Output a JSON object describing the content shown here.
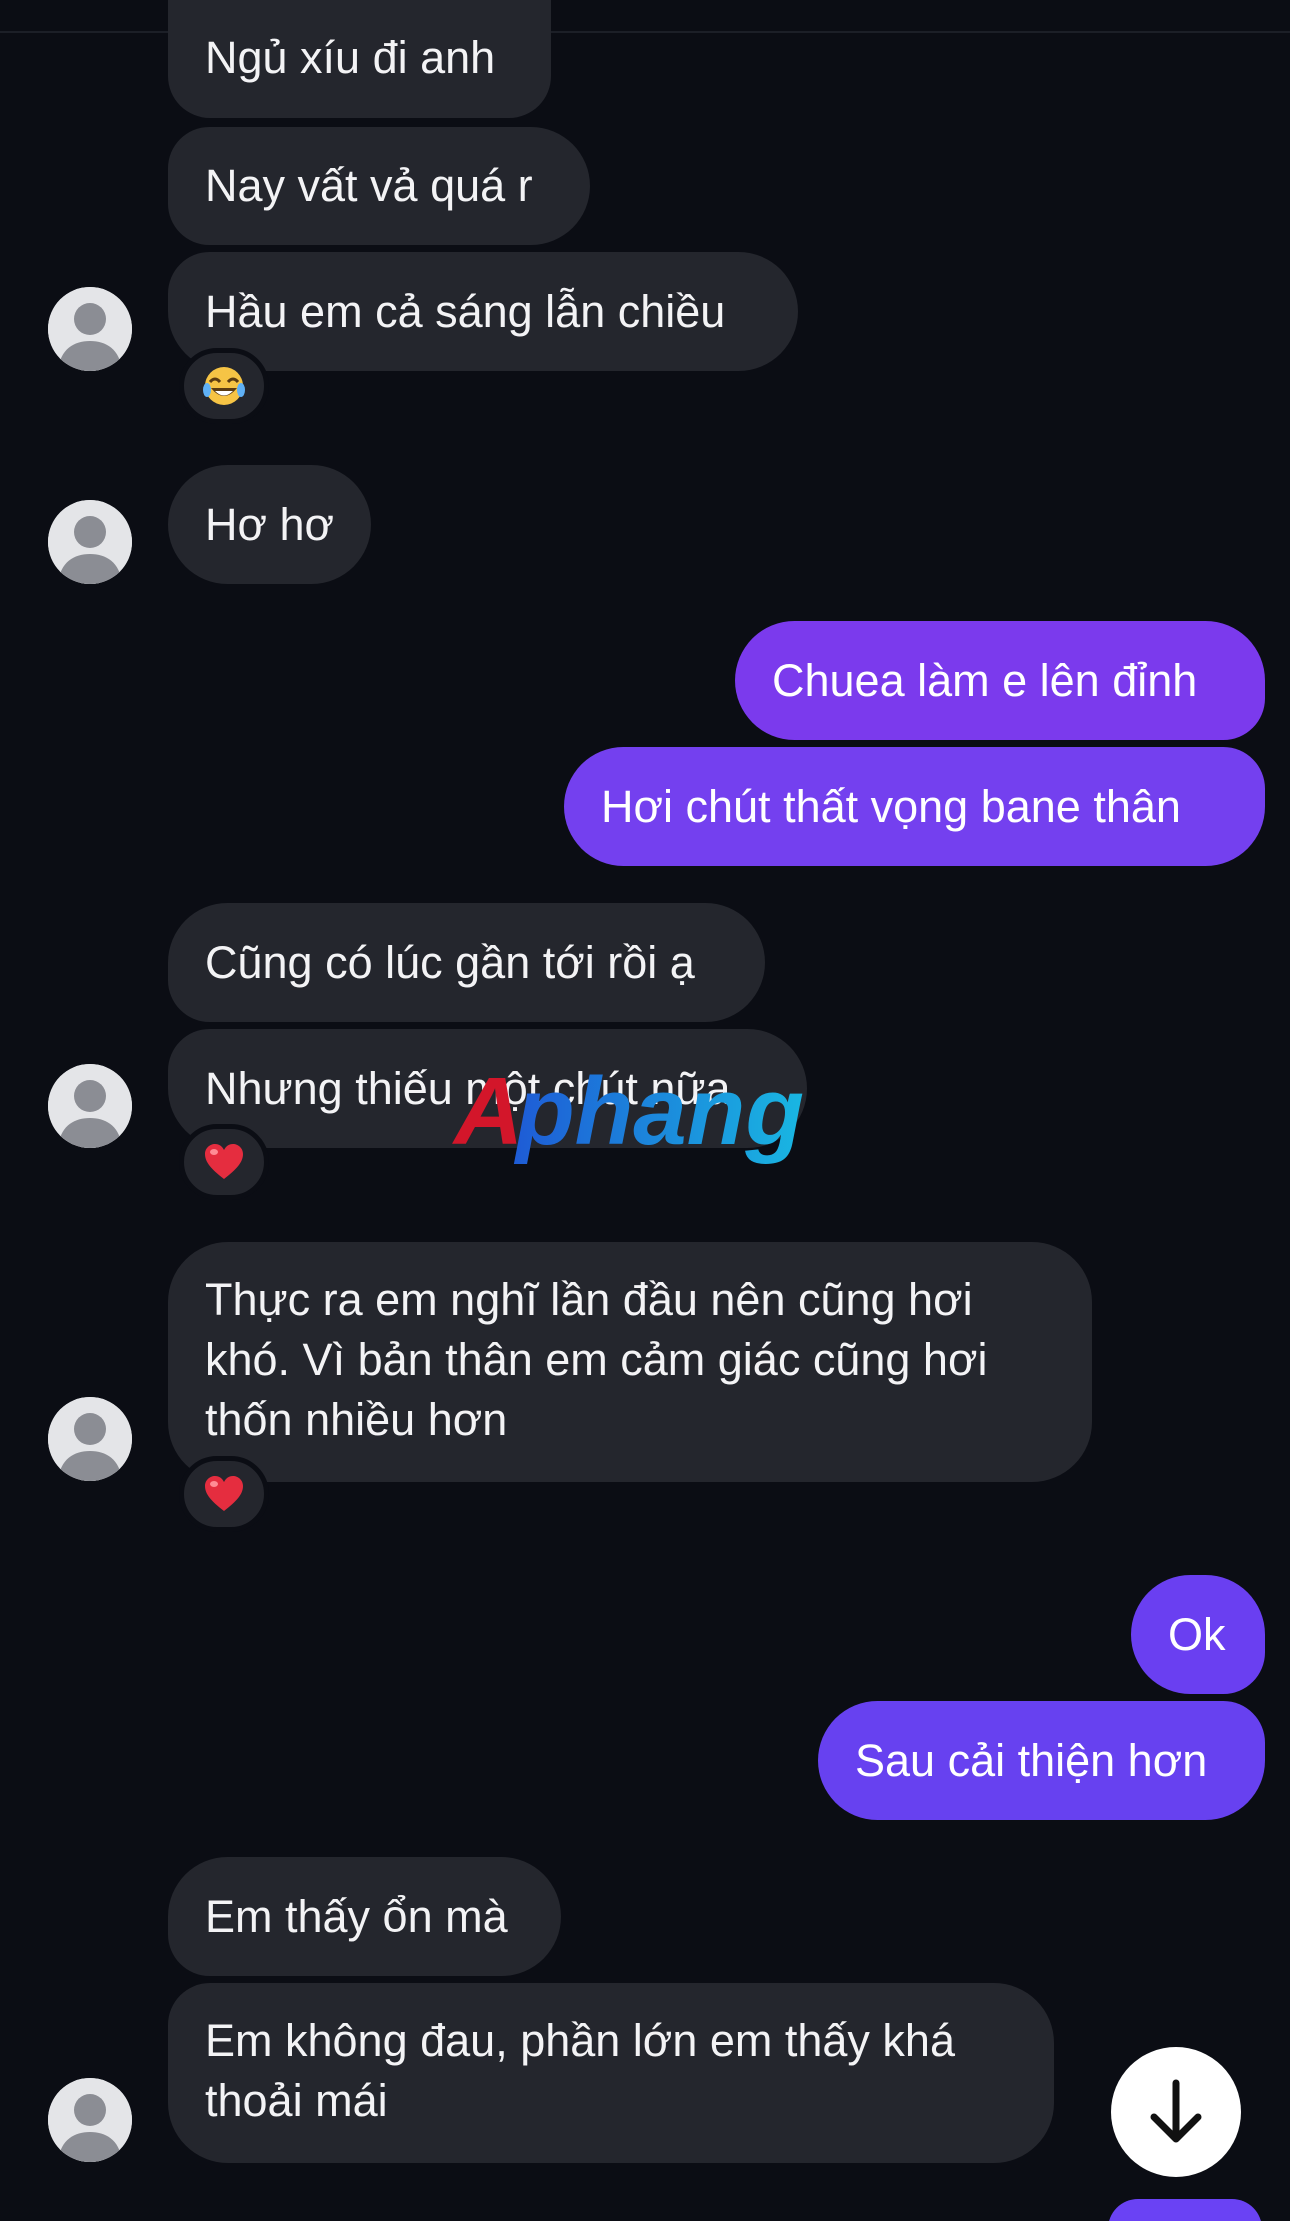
{
  "colors": {
    "background": "#0b0d14",
    "incoming_bubble": "#24262d",
    "outgoing_purple": "#7b3aed",
    "outgoing_indigo": "#6741f0"
  },
  "messages": [
    {
      "id": "m1",
      "direction": "incoming",
      "text": "Ngủ xíu đi anh"
    },
    {
      "id": "m2",
      "direction": "incoming",
      "text": "Nay vất vả quá r"
    },
    {
      "id": "m3",
      "direction": "incoming",
      "text": "Hầu em cả sáng lẫn chiều",
      "reaction": "😂"
    },
    {
      "id": "m4",
      "direction": "incoming",
      "text": "Hơ hơ"
    },
    {
      "id": "m5",
      "direction": "outgoing",
      "text": "Chuea làm e lên đỉnh"
    },
    {
      "id": "m6",
      "direction": "outgoing",
      "text": "Hơi chút thất vọng bane thân"
    },
    {
      "id": "m7",
      "direction": "incoming",
      "text": "Cũng có lúc gần tới rồi ạ"
    },
    {
      "id": "m8",
      "direction": "incoming",
      "text": "Nhưng thiếu một chút nữa",
      "reaction": "❤️"
    },
    {
      "id": "m9",
      "direction": "incoming",
      "lines": [
        "Thực ra em nghĩ lần đầu nên cũng hơi",
        "khó. Vì bản thân em cảm giác cũng hơi",
        "thốn nhiều hơn"
      ],
      "reaction": "❤️"
    },
    {
      "id": "m10",
      "direction": "outgoing",
      "text": "Ok"
    },
    {
      "id": "m11",
      "direction": "outgoing",
      "text": "Sau cải thiện hơn"
    },
    {
      "id": "m12",
      "direction": "incoming",
      "text": "Em thấy ổn mà"
    },
    {
      "id": "m13",
      "direction": "incoming",
      "lines": [
        "Em không đau, phần lớn em thấy khá",
        "thoải mái"
      ]
    }
  ],
  "icons": {
    "avatar": "default-person-avatar-icon",
    "scroll_down": "arrow-down-icon",
    "reaction_laugh": "tears-of-joy-emoji",
    "reaction_heart": "red-heart-emoji"
  },
  "watermark": "Aphang"
}
